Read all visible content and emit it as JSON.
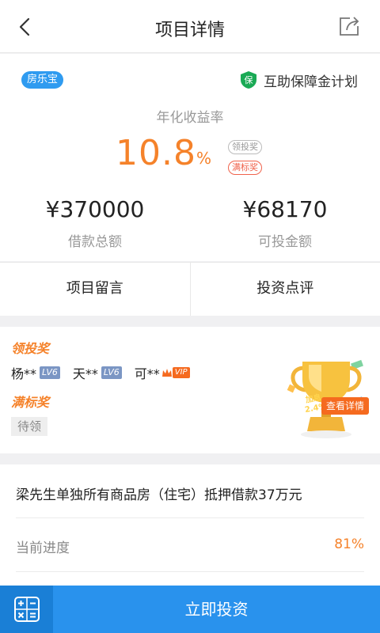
{
  "navbar": {
    "title": "项目详情",
    "back_icon": "chevron-left-icon",
    "share_icon": "share-icon"
  },
  "summary": {
    "product_tag": "房乐宝",
    "guarantee": {
      "icon_text": "保",
      "label": "互助保障金计划"
    },
    "rate_label": "年化收益率",
    "rate_value": "10.8",
    "rate_unit": "%",
    "badges": {
      "invest": "领投奖",
      "full": "满标奖"
    },
    "total_amount": {
      "value": "¥370000",
      "label": "借款总额"
    },
    "available_amount": {
      "value": "¥68170",
      "label": "可投金额"
    }
  },
  "actions": {
    "comments": "项目留言",
    "reviews": "投资点评"
  },
  "rewards": {
    "invest_title": "领投奖",
    "winners": [
      {
        "name": "杨**",
        "badge": "LV6"
      },
      {
        "name": "天**",
        "badge": "LV6"
      },
      {
        "name": "可**",
        "badge": "VIP"
      }
    ],
    "full_title": "满标奖",
    "pending": "待领",
    "boost_text": "加息\n2.4%",
    "detail_button": "查看详情"
  },
  "project": {
    "title": "梁先生单独所有商品房（住宅）抵押借款37万元",
    "progress_label": "当前进度",
    "progress_value": "81%",
    "progress": 0.81
  },
  "bottom": {
    "calc_icon": "calculator-icon",
    "invest_button": "立即投资"
  },
  "colors": {
    "accent": "#2992ed",
    "highlight": "#f5822a",
    "guarantee": "#1aaa55"
  }
}
